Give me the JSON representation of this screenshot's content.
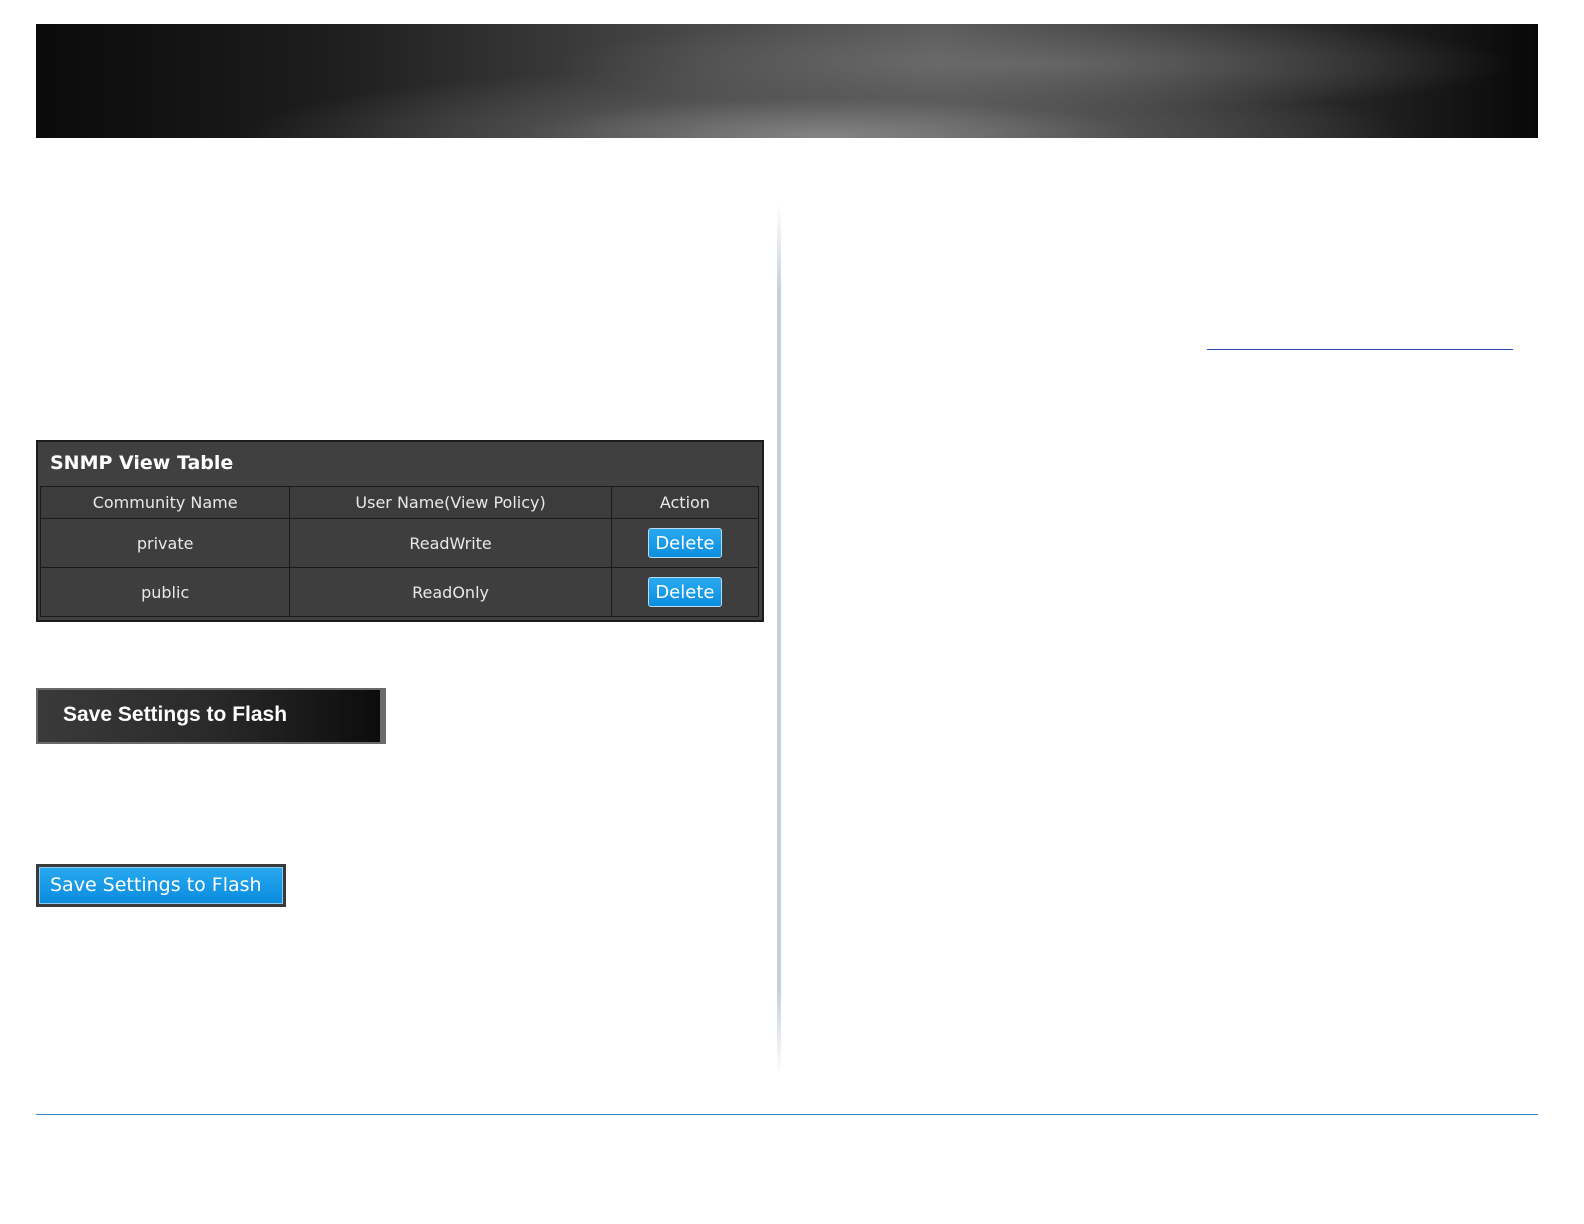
{
  "snmp_view_table": {
    "title": "SNMP View Table",
    "columns": [
      "Community Name",
      "User Name(View Policy)",
      "Action"
    ],
    "rows": [
      {
        "community_name": "private",
        "user_name": "ReadWrite",
        "action": "Delete"
      },
      {
        "community_name": "public",
        "user_name": "ReadOnly",
        "action": "Delete"
      }
    ]
  },
  "buttons": {
    "save_dark_label": "Save Settings to Flash",
    "save_blue_label": "Save Settings to Flash"
  }
}
